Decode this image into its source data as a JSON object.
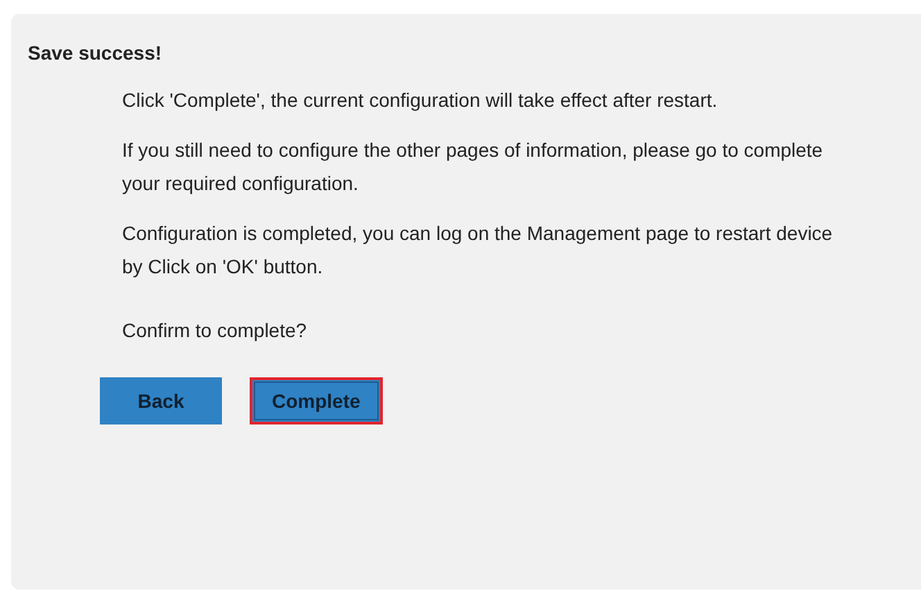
{
  "dialog": {
    "title": "Save success!",
    "paragraphs": [
      "Click 'Complete', the current configuration will take effect after restart.",
      "If you still need to configure the other pages of information, please go to complete your required configuration.",
      "Configuration is completed, you can log on the Management page to restart device by Click on 'OK' button."
    ],
    "question": "Confirm to complete?",
    "buttons": [
      {
        "label": "Back",
        "focused": false
      },
      {
        "label": "Complete",
        "focused": true
      }
    ]
  }
}
